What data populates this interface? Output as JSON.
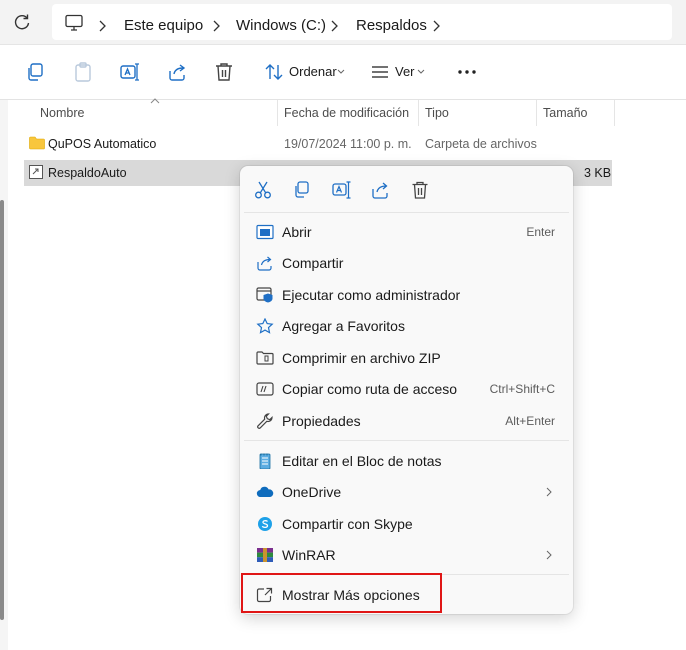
{
  "address_bar": {
    "crumbs": [
      "Este equipo",
      "Windows (C:)",
      "Respaldos"
    ]
  },
  "command_bar": {
    "sort_label": "Ordenar",
    "view_label": "Ver"
  },
  "columns": [
    "Nombre",
    "Fecha de modificación",
    "Tipo",
    "Tamaño"
  ],
  "rows": [
    {
      "name": "QuPOS Automatico",
      "date": "19/07/2024 11:00 p. m.",
      "type": "Carpeta de archivos",
      "size": ""
    },
    {
      "name": "RespaldoAuto",
      "date": "",
      "type": "",
      "size": "3 KB"
    }
  ],
  "context_menu": {
    "items": [
      {
        "label": "Abrir",
        "accel": "Enter",
        "icon": "open-icon"
      },
      {
        "label": "Compartir",
        "accel": "",
        "icon": "share-icon"
      },
      {
        "label": "Ejecutar como administrador",
        "accel": "",
        "icon": "admin-shield-icon"
      },
      {
        "label": "Agregar a Favoritos",
        "accel": "",
        "icon": "star-icon"
      },
      {
        "label": "Comprimir en archivo ZIP",
        "accel": "",
        "icon": "zip-icon"
      },
      {
        "label": "Copiar como ruta de acceso",
        "accel": "Ctrl+Shift+C",
        "icon": "copy-path-icon"
      },
      {
        "label": "Propiedades",
        "accel": "Alt+Enter",
        "icon": "wrench-icon"
      },
      {
        "label": "Editar en el Bloc de notas",
        "accel": "",
        "icon": "notepad-icon"
      },
      {
        "label": "OneDrive",
        "accel": "",
        "icon": "onedrive-icon"
      },
      {
        "label": "Compartir con Skype",
        "accel": "",
        "icon": "skype-icon"
      },
      {
        "label": "WinRAR",
        "accel": "",
        "icon": "winrar-icon"
      },
      {
        "label": "Mostrar Más opciones",
        "accel": "",
        "icon": "more-options-icon"
      }
    ]
  },
  "colors": {
    "accent": "#0067c0",
    "highlight_box": "#e01616",
    "selection": "#d9d9d9"
  }
}
